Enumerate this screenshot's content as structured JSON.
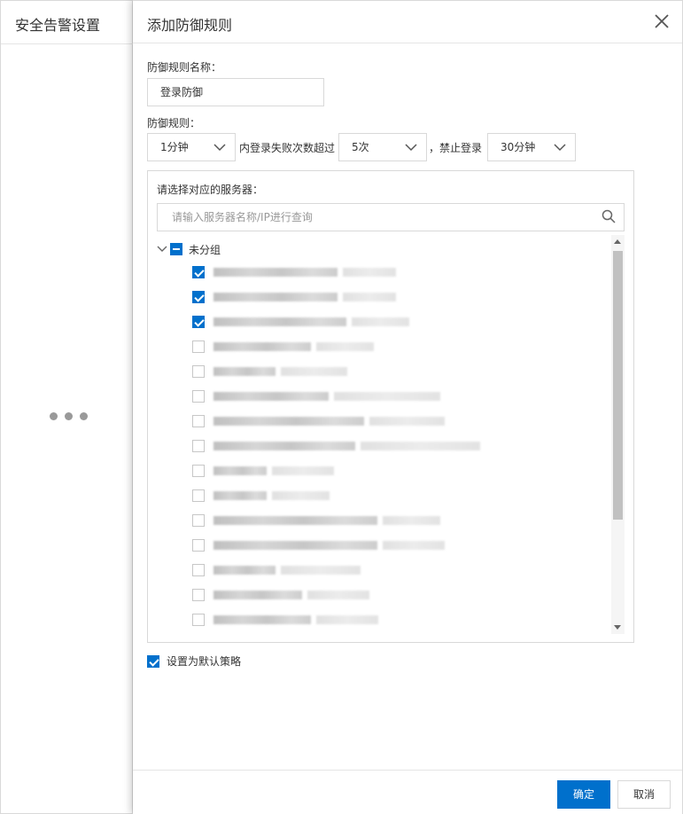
{
  "background_panel": {
    "title": "安全告警设置"
  },
  "drawer": {
    "title": "添加防御规则",
    "rule_name_label": "防御规则名称：",
    "rule_name_value": "登录防御",
    "rule_label": "防御规则：",
    "time_window": "1分钟",
    "fail_text": "内登录失败次数超过",
    "fail_count": "5次",
    "ban_text": "，禁止登录",
    "ban_duration": "30分钟",
    "server_select_label": "请选择对应的服务器：",
    "search_placeholder": "请输入服务器名称/IP进行查询",
    "group_label": "未分组",
    "servers": [
      {
        "checked": true
      },
      {
        "checked": true
      },
      {
        "checked": true
      },
      {
        "checked": false
      },
      {
        "checked": false
      },
      {
        "checked": false
      },
      {
        "checked": false
      },
      {
        "checked": false
      },
      {
        "checked": false
      },
      {
        "checked": false
      },
      {
        "checked": false
      },
      {
        "checked": false
      },
      {
        "checked": false
      },
      {
        "checked": false
      },
      {
        "checked": false
      }
    ],
    "default_policy_label": "设置为默认策略",
    "default_policy_checked": true,
    "confirm_label": "确定",
    "cancel_label": "取消"
  },
  "colors": {
    "primary": "#0070cc",
    "border": "#d9d9d9"
  }
}
